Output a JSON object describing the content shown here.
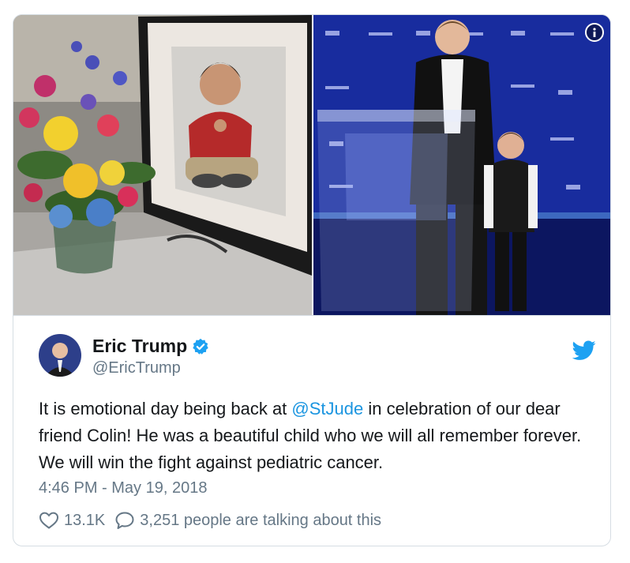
{
  "tweet": {
    "display_name": "Eric Trump",
    "handle": "@EricTrump",
    "text_before": "It is emotional day being back at ",
    "mention": "@StJude",
    "text_after": " in celebration of our dear friend Colin! He was a beautiful child who we will all remember forever. We will win the fight against pediatric cancer.",
    "timestamp": "4:46 PM - May 19, 2018",
    "likes": "13.1K",
    "talking": "3,251 people are talking about this"
  },
  "icons": {
    "verified": "verified-badge-icon",
    "brand": "twitter-bird-icon",
    "like": "heart-icon",
    "reply": "speech-bubble-icon",
    "info": "info-icon"
  },
  "colors": {
    "text": "#14171a",
    "muted": "#657786",
    "link": "#1b95e0",
    "twitter_blue": "#1da1f2",
    "border": "#d6dde3"
  }
}
